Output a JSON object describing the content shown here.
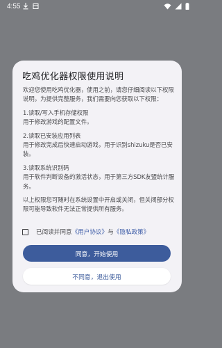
{
  "status_bar": {
    "time": "4:55",
    "left_icons": [
      "download-icon",
      "notification-icon"
    ],
    "right_icons": [
      "wifi-icon",
      "signal-icon",
      "battery-icon"
    ]
  },
  "dialog": {
    "title": "吃鸡优化器权限使用说明",
    "intro": "欢迎您使用吃鸡优化器，使用之前，请您仔细阅读以下权限说明，为提供完整服务，我们需要向您获取以下权限：",
    "sections": [
      {
        "heading": "1.读取/写入手机存储权限",
        "description": "用于修改游戏的配置文件。"
      },
      {
        "heading": "2.读取已安装应用列表",
        "description": "用于修改完成后快速启动游戏，用于识别shizuku是否已安装。"
      },
      {
        "heading": "3.读取系统识别码",
        "description": "用于软件判断设备的激活状态，用于第三方SDK友盟统计服务。"
      }
    ],
    "footer_note": "以上权限您可随时在系统设置中开启或关闭，但关闭部分权限可能导致软件无法正常提供所有服务。",
    "consent": {
      "prefix": "已阅读并同意",
      "user_agreement": "《用户协议》",
      "connector": "与",
      "privacy_policy": "《隐私政策》",
      "checked": false
    },
    "agree_button": "同意，开始使用",
    "disagree_button": "不同意，退出使用"
  },
  "colors": {
    "primary": "#3d5c9c",
    "link": "#3f5ea8",
    "dialog_bg": "#f3f2f6",
    "scrim": "#7a7c80"
  }
}
